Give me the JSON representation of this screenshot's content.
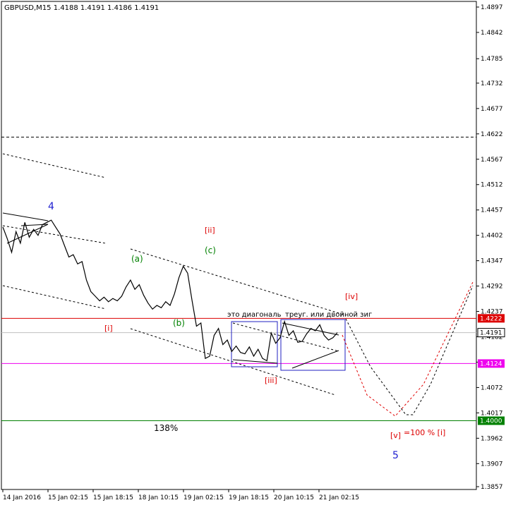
{
  "chart_data": {
    "type": "line",
    "title": "GBPUSD,M15  1.4188 1.4191 1.4186 1.4191",
    "symbol": "GBPUSD",
    "timeframe": "M15",
    "ohlc": {
      "open": 1.4188,
      "high": 1.4191,
      "low": 1.4186,
      "close": 1.4191
    },
    "y_ticks": [
      1.4897,
      1.4842,
      1.4785,
      1.4732,
      1.4677,
      1.4622,
      1.4567,
      1.4512,
      1.4457,
      1.4402,
      1.4347,
      1.4292,
      1.4237,
      1.4182,
      1.4127,
      1.4072,
      1.4017,
      1.3962,
      1.3907,
      1.3857
    ],
    "x_ticks": [
      "14 Jan 2016",
      "15 Jan 02:15",
      "15 Jan 18:15",
      "18 Jan 10:15",
      "19 Jan 02:15",
      "19 Jan 18:15",
      "20 Jan 10:15",
      "21 Jan 02:15"
    ],
    "ylim": [
      1.3857,
      1.4897
    ],
    "price_tag": {
      "value": "1.4191",
      "color": "#ffffff"
    },
    "levels": [
      {
        "value": 1.4222,
        "label": "1.4222",
        "color": "#dd0000"
      },
      {
        "value": 1.4124,
        "label": "1.4124",
        "color": "#ee00ee"
      },
      {
        "value": 1.4,
        "label": "1.4000",
        "color": "#008000"
      },
      {
        "value": 1.4615,
        "label": "",
        "color": "#000000"
      }
    ],
    "price_series": [
      [
        0,
        1.442
      ],
      [
        1,
        1.4395
      ],
      [
        2,
        1.4365
      ],
      [
        3,
        1.441
      ],
      [
        4,
        1.4385
      ],
      [
        5,
        1.443
      ],
      [
        6,
        1.4398
      ],
      [
        7,
        1.4415
      ],
      [
        8,
        1.4402
      ],
      [
        9,
        1.4425
      ],
      [
        10,
        1.443
      ],
      [
        11,
        1.4435
      ],
      [
        12,
        1.442
      ],
      [
        13,
        1.4405
      ],
      [
        14,
        1.438
      ],
      [
        15,
        1.4355
      ],
      [
        16,
        1.436
      ],
      [
        17,
        1.434
      ],
      [
        18,
        1.4345
      ],
      [
        19,
        1.4305
      ],
      [
        20,
        1.428
      ],
      [
        21,
        1.427
      ],
      [
        22,
        1.426
      ],
      [
        23,
        1.4268
      ],
      [
        24,
        1.4258
      ],
      [
        25,
        1.4265
      ],
      [
        26,
        1.426
      ],
      [
        27,
        1.427
      ],
      [
        28,
        1.429
      ],
      [
        29,
        1.4305
      ],
      [
        30,
        1.4285
      ],
      [
        31,
        1.4295
      ],
      [
        32,
        1.4272
      ],
      [
        33,
        1.4255
      ],
      [
        34,
        1.4242
      ],
      [
        35,
        1.425
      ],
      [
        36,
        1.4245
      ],
      [
        37,
        1.4258
      ],
      [
        38,
        1.425
      ],
      [
        39,
        1.4275
      ],
      [
        40,
        1.431
      ],
      [
        41,
        1.4335
      ],
      [
        42,
        1.432
      ],
      [
        43,
        1.426
      ],
      [
        44,
        1.4205
      ],
      [
        45,
        1.4212
      ],
      [
        46,
        1.4135
      ],
      [
        47,
        1.414
      ],
      [
        48,
        1.4185
      ],
      [
        49,
        1.42
      ],
      [
        50,
        1.4165
      ],
      [
        51,
        1.4175
      ],
      [
        52,
        1.415
      ],
      [
        53,
        1.4162
      ],
      [
        54,
        1.4148
      ],
      [
        55,
        1.4145
      ],
      [
        56,
        1.416
      ],
      [
        57,
        1.414
      ],
      [
        58,
        1.4155
      ],
      [
        59,
        1.4135
      ],
      [
        60,
        1.413
      ],
      [
        61,
        1.419
      ],
      [
        62,
        1.4168
      ],
      [
        63,
        1.418
      ],
      [
        64,
        1.4215
      ],
      [
        65,
        1.4185
      ],
      [
        66,
        1.4195
      ],
      [
        67,
        1.417
      ],
      [
        68,
        1.4172
      ],
      [
        69,
        1.4188
      ],
      [
        70,
        1.42
      ],
      [
        71,
        1.4195
      ],
      [
        72,
        1.4208
      ],
      [
        73,
        1.4185
      ],
      [
        74,
        1.4175
      ],
      [
        75,
        1.418
      ],
      [
        76,
        1.4191
      ]
    ],
    "series_x_range": [
      0,
      76
    ],
    "annotations": {
      "wave_4": "4",
      "wave_5": "5",
      "wave_i": "[i]",
      "wave_ii": "[ii]",
      "wave_iii": "[iii]",
      "wave_iv": "[iv]",
      "wave_v": "[v]",
      "wave_a": "(a)",
      "wave_b": "(b)",
      "wave_c": "(c)",
      "pct_138": "138%",
      "target_note": "=100 % [i]",
      "note_1": "это диагональ",
      "note_2": "треуг. или двойной зиг"
    }
  }
}
